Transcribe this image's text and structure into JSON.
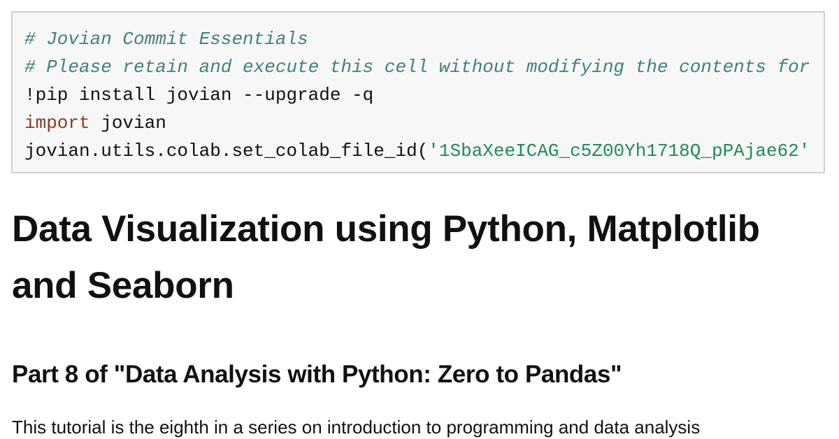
{
  "code_cell": {
    "lines": [
      {
        "comment": "# Jovian Commit Essentials"
      },
      {
        "comment": "# Please retain and execute this cell without modifying the contents for"
      },
      {
        "plain": "!pip install jovian --upgrade -q"
      },
      {
        "keyword": "import",
        "plain": " jovian"
      },
      {
        "plain": "jovian.utils.colab.set_colab_file_id(",
        "string": "'1SbaXeeICAG_c5Z00Yh1718Q_pPAjae62'"
      }
    ]
  },
  "markdown": {
    "title": "Data Visualization using Python, Matplotlib and Seaborn",
    "subtitle": "Part 8 of \"Data Analysis with Python: Zero to Pandas\"",
    "paragraph": "This tutorial is the eighth in a series on introduction to programming and data analysis"
  },
  "colors": {
    "comment": "#408080",
    "keyword": "#8b3a1e",
    "string": "#1f8a5a",
    "code_background": "#f7f7f7",
    "code_border": "#cfcfcf",
    "text": "#111111"
  }
}
